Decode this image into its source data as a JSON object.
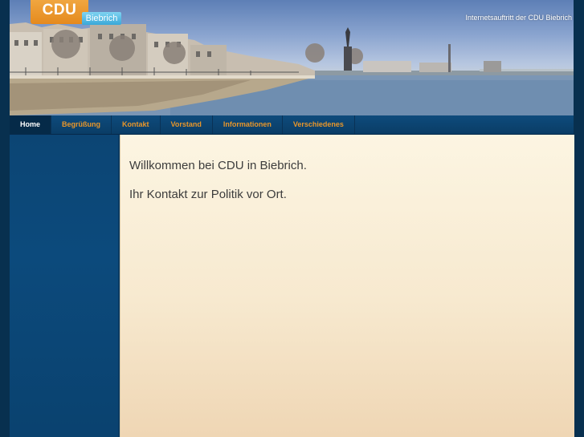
{
  "header": {
    "logo_text": "CDU",
    "logo_sub": "Biebrich",
    "tagline": "Internetsauftritt der CDU Biebrich"
  },
  "nav": {
    "items": [
      {
        "label": "Home"
      },
      {
        "label": "Begrüßung"
      },
      {
        "label": "Kontakt"
      },
      {
        "label": "Vorstand"
      },
      {
        "label": "Informationen"
      },
      {
        "label": "Verschiedenes"
      }
    ]
  },
  "main": {
    "welcome": "Willkommen bei CDU in Biebrich.",
    "contact": "Ihr Kontakt zur Politik vor Ort."
  },
  "colors": {
    "nav_text": "#e8962a",
    "nav_active_bg": "#052a48",
    "logo_orange": "#e58a1e",
    "content_bg": "#fcf5e2"
  }
}
